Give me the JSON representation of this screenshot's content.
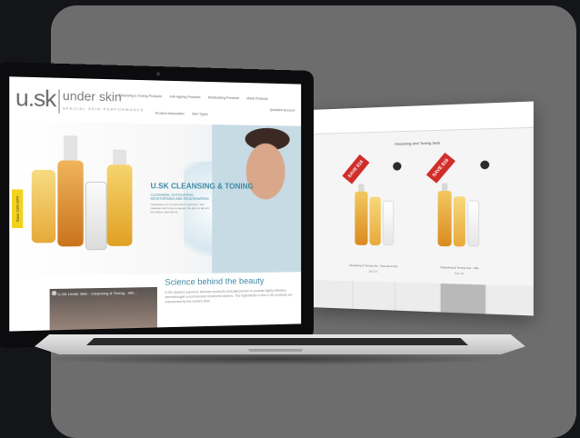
{
  "brand": {
    "logo": "u.sk",
    "name": "under skin",
    "tagline": "SPECIAL SKIN PERFORMANCE"
  },
  "nav": {
    "items": [
      "Cleansing & Toning Products",
      "Anti-Ageing Products",
      "Moisturising Products",
      "Mask Products"
    ],
    "secondary": [
      "Product Information",
      "Skin Types"
    ],
    "account": "Quicklink Account"
  },
  "promo_tab": "Save 10% OFF",
  "hero": {
    "title": "U.SK CLEANSING & TONING",
    "subtitle": "CLEANSING, EXFOLIATING, MOISTURISING AND REJUVENATING",
    "description": "Cleansing is a crucial step in skincare. Our cleanser and toners prepare the skin to absorb the active ingredients."
  },
  "video": {
    "title": "U.SK Under Skin - Cleansing & Toning - Wh..."
  },
  "science": {
    "title": "Science behind the beauty",
    "text": "U.SK delivers supreme skincare products clinically proven to provide highly effective, dermatologist recommended treatment options. The ingredients in the U.SK products are researched by the world's best."
  },
  "side_page": {
    "title": "Cleansing and Toning Sets",
    "products": [
      {
        "sale": "SAVE $16",
        "name": "Cleansing & Toning Set - Normal to Dry",
        "price": "$00.00"
      },
      {
        "sale": "SAVE $16",
        "name": "Cleansing & Toning Set - Oily",
        "price": "$00.00"
      }
    ]
  },
  "colors": {
    "accent": "#3e8aa5",
    "sale": "#d12d2a",
    "promo": "#f3d21b",
    "backdrop": "#6d6d6d",
    "background": "#141519"
  }
}
